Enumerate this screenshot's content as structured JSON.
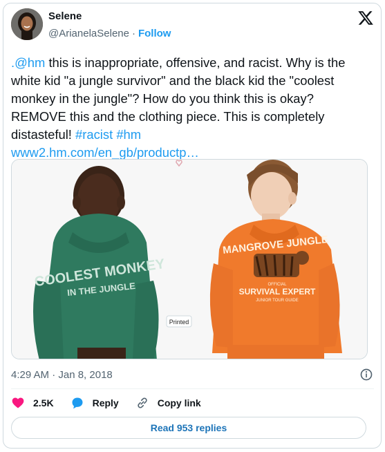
{
  "user": {
    "name": "Selene",
    "handle": "@ArianelaSelene",
    "separator": "·",
    "follow_label": "Follow"
  },
  "tweet": {
    "mention": ".@hm",
    "text_1": " this is inappropriate, offensive, and racist. Why is the white kid \"a jungle survivor\" and the black kid the \"coolest monkey in the jungle\"? How do you think this is okay? REMOVE this and the clothing piece. This is completely distasteful! ",
    "hashtag_1": "#racist",
    "space": " ",
    "hashtag_2": "#hm",
    "link": "www2.hm.com/en_gb/productp…"
  },
  "media": {
    "left_hoodie_text_1": "COOLEST MONKEY",
    "left_hoodie_text_2": "IN THE JUNGLE",
    "right_hoodie_text_1": "MANGROVE JUNGLE",
    "right_hoodie_text_2": "OFFICIAL",
    "right_hoodie_text_3": "SURVIVAL EXPERT",
    "right_hoodie_text_4": "JUNIOR TOUR GUIDE",
    "tag_label": "Printed"
  },
  "meta": {
    "timestamp": "4:29 AM · Jan 8, 2018"
  },
  "actions": {
    "likes": "2.5K",
    "reply_label": "Reply",
    "copy_label": "Copy link"
  },
  "replies_button": "Read 953 replies",
  "colors": {
    "accent": "#1d9bf0",
    "heart": "#f91880",
    "left_hoodie": "#2f7a5f",
    "right_hoodie": "#f07a2c"
  },
  "icons": [
    "x-logo-icon",
    "info-icon",
    "heart-icon",
    "reply-icon",
    "link-icon"
  ]
}
